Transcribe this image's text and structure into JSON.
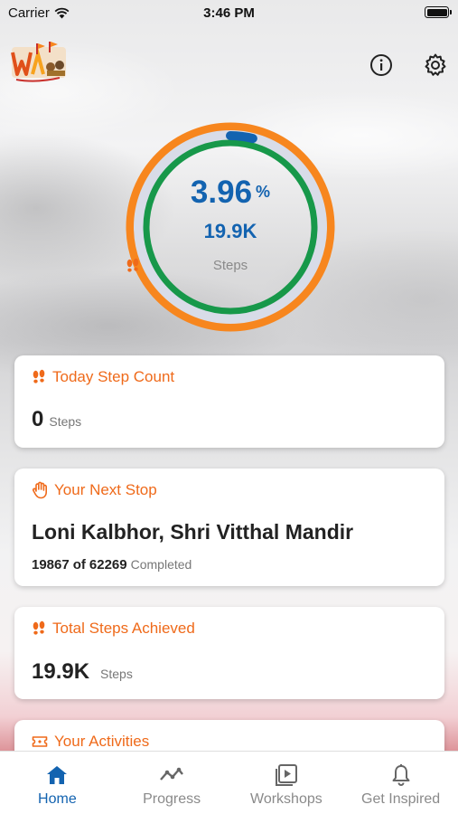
{
  "status_bar": {
    "carrier": "Carrier",
    "time": "3:46 PM"
  },
  "header": {
    "logo_icon": "wari-logo-icon",
    "info_icon": "info-icon",
    "settings_icon": "gear-icon"
  },
  "progress_ring": {
    "percent_value": "3.96",
    "percent_sign": "%",
    "progress_fraction": 0.0396,
    "steps_value": "19.9K",
    "steps_label": "Steps",
    "colors": {
      "outer": "#f7861e",
      "middle": "#d8dce8",
      "inner": "#17984a",
      "marker": "#1363b0",
      "text": "#1363b0"
    }
  },
  "cards": {
    "today": {
      "title": "Today Step Count",
      "value": "0",
      "unit": "Steps"
    },
    "next_stop": {
      "title": "Your Next Stop",
      "place": "Loni Kalbhor, Shri Vitthal Mandir",
      "done": "19867",
      "of_word": "of",
      "total": "62269",
      "status": "Completed"
    },
    "total": {
      "title": "Total Steps Achieved",
      "value": "19.9K",
      "unit": "Steps"
    },
    "activities": {
      "title": "Your Activities"
    }
  },
  "tabs": [
    {
      "label": "Home",
      "icon": "home-icon",
      "active": true
    },
    {
      "label": "Progress",
      "icon": "trend-icon",
      "active": false
    },
    {
      "label": "Workshops",
      "icon": "play-icon",
      "active": false
    },
    {
      "label": "Get Inspired",
      "icon": "bell-icon",
      "active": false
    }
  ],
  "accent_colors": {
    "orange": "#ef6a1a",
    "blue": "#1363b0"
  }
}
